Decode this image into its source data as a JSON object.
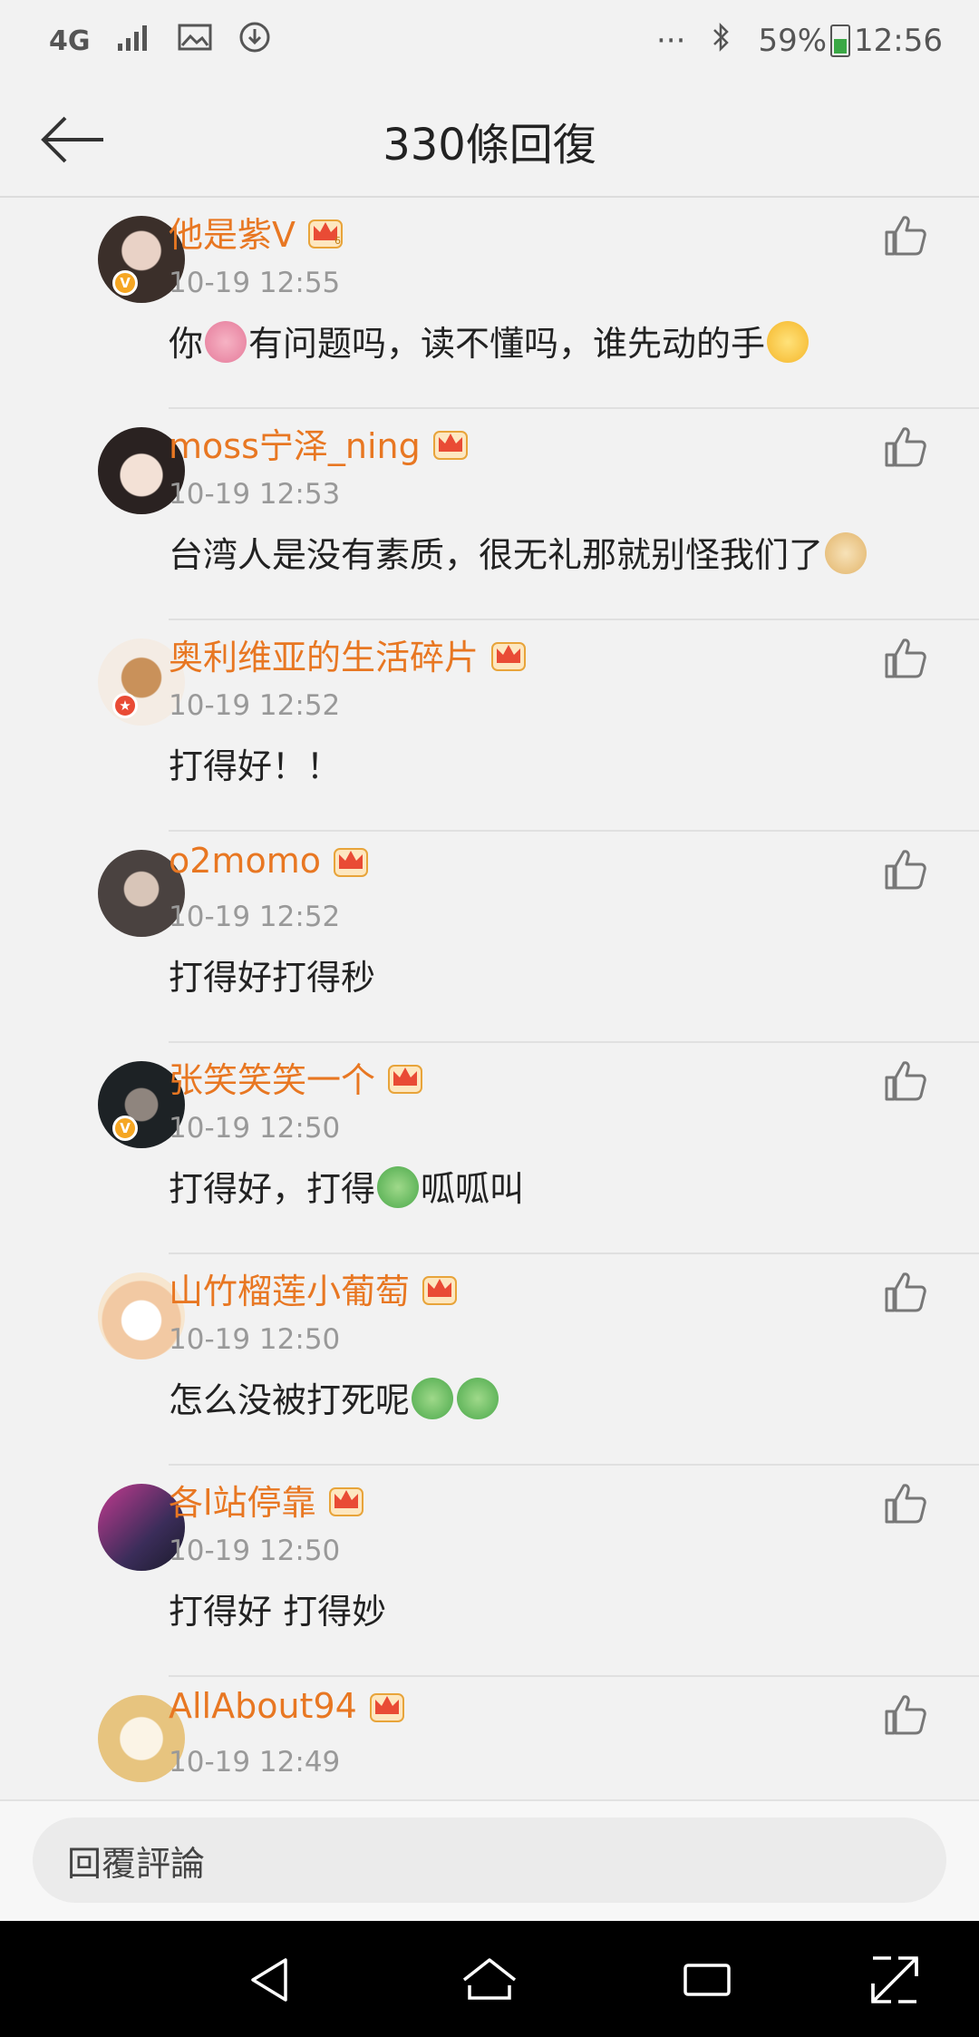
{
  "status_bar": {
    "network": "4G",
    "more": "···",
    "battery": "59%",
    "time": "12:56"
  },
  "header": {
    "title": "330條回復"
  },
  "comments": [
    {
      "username": "他是紫V",
      "time": "10-19 12:55",
      "content_parts": [
        "你",
        "有问题吗，读不懂吗，谁先动的手",
        ""
      ],
      "avatar_color": "#5a4a42",
      "badge": "V"
    },
    {
      "username": "moss宁泽_ning",
      "time": "10-19 12:53",
      "content_parts": [
        "台湾人是没有素质，很无礼那就别怪我们了",
        ""
      ],
      "avatar_color": "#c9b3a8",
      "badge": ""
    },
    {
      "username": "奥利维亚的生活碎片",
      "time": "10-19 12:52",
      "content": "打得好！！",
      "avatar_color": "#d9b48a",
      "badge": "★"
    },
    {
      "username": "o2momo",
      "time": "10-19 12:52",
      "content": "打得好打得秒",
      "avatar_color": "#6e6560",
      "badge": ""
    },
    {
      "username": "张笑笑笑一个",
      "time": "10-19 12:50",
      "content_parts": [
        "打得好，打得",
        "呱呱叫"
      ],
      "avatar_color": "#2e3438",
      "badge": "V"
    },
    {
      "username": "山竹榴莲小葡萄",
      "time": "10-19 12:50",
      "content_parts": [
        "怎么没被打死呢",
        ""
      ],
      "avatar_color": "#f3d9b8",
      "badge": ""
    },
    {
      "username": "各l站停靠",
      "time": "10-19 12:50",
      "content": "打得好 打得妙",
      "avatar_color": "#7a3a6e",
      "badge": ""
    },
    {
      "username": "AllAbout94",
      "time": "10-19 12:49",
      "content": "",
      "avatar_color": "#e7c47f",
      "badge": ""
    }
  ],
  "reply_bar": {
    "placeholder": "回覆評論"
  },
  "colors": {
    "username": "#e87722",
    "time": "#999999",
    "background": "#f2f2f2"
  }
}
